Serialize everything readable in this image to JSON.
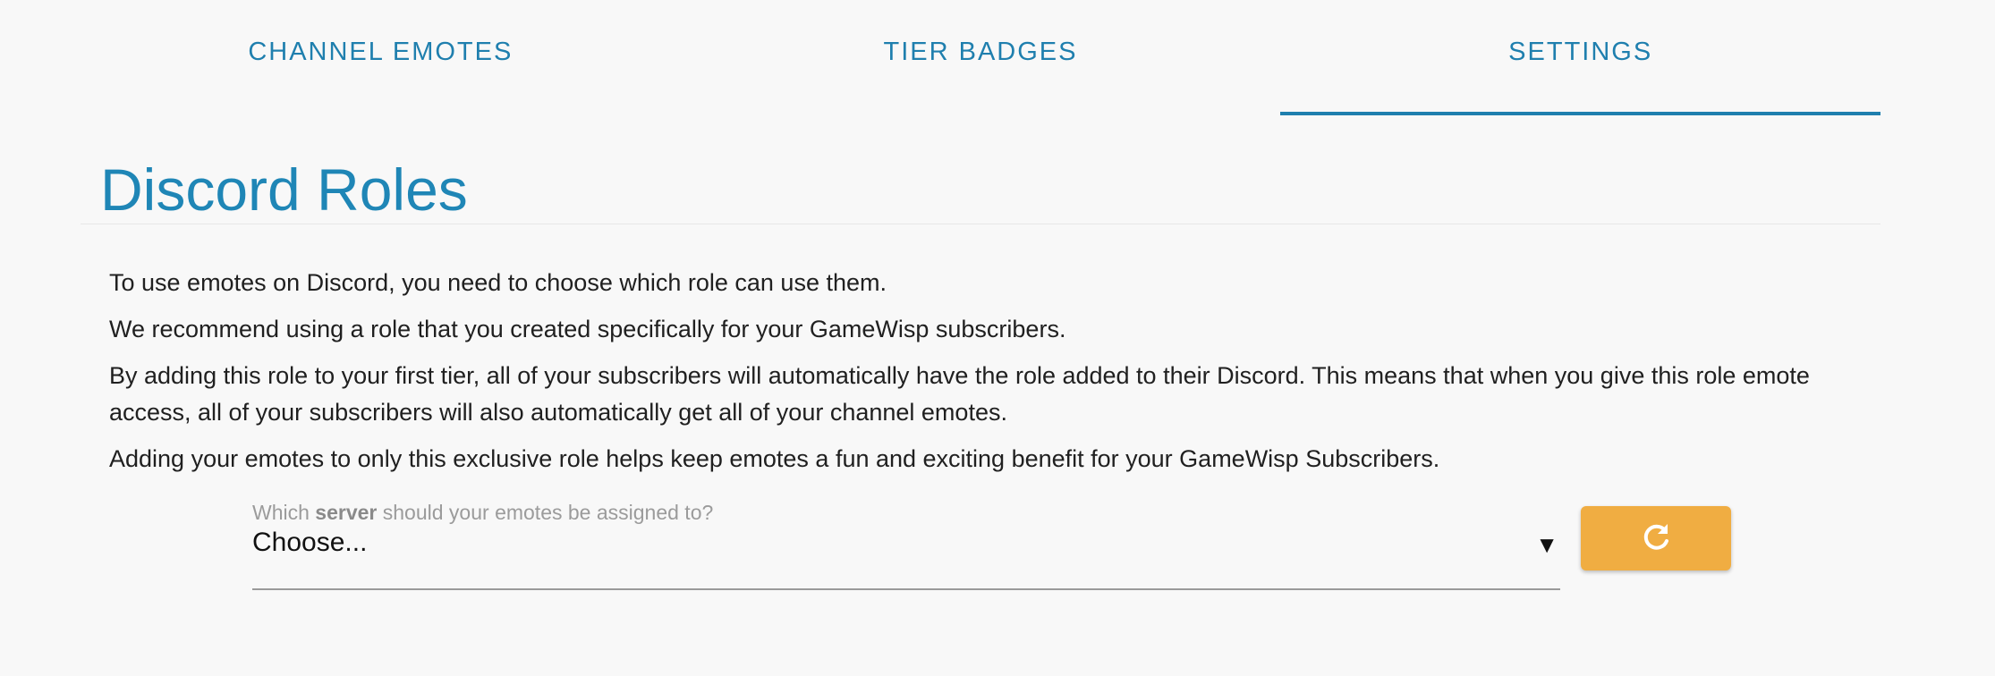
{
  "tabs": [
    {
      "label": "CHANNEL EMOTES",
      "active": false
    },
    {
      "label": "TIER BADGES",
      "active": false
    },
    {
      "label": "SETTINGS",
      "active": true
    }
  ],
  "page": {
    "title": "Discord Roles"
  },
  "content": {
    "paragraphs": [
      "To use emotes on Discord, you need to choose which role can use them.",
      "We recommend using a role that you created specifically for your GameWisp subscribers.",
      "By adding this role to your first tier, all of your subscribers will automatically have the role added to their Discord. This means that when you give this role emote access, all of your subscribers will also automatically get all of your channel emotes.",
      "Adding your emotes to only this exclusive role helps keep emotes a fun and exciting benefit for your GameWisp Subscribers."
    ]
  },
  "server_select": {
    "label_prefix": "Which",
    "label_bold": "server",
    "label_suffix": "should your emotes be assigned to?",
    "value": "Choose...",
    "arrow_glyph": "▼"
  },
  "refresh_button": {
    "icon": "refresh-icon",
    "color": "#f0ad42"
  },
  "colors": {
    "accent": "#1f7fae",
    "button": "#f0ad42",
    "background": "#f8f8f8"
  }
}
